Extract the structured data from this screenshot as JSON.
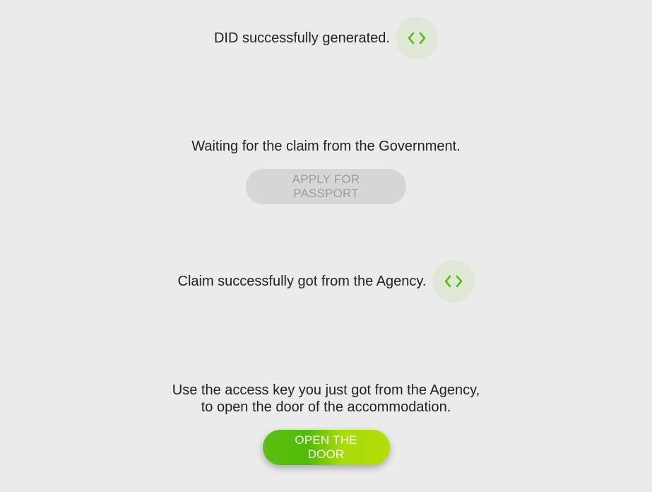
{
  "steps": {
    "did": {
      "message": "DID successfully generated.",
      "icon": "code-icon"
    },
    "government": {
      "message": "Waiting for the claim from the Government.",
      "button_label": "APPLY FOR PASSPORT"
    },
    "agency": {
      "message": "Claim successfully got from the Agency.",
      "icon": "code-icon"
    },
    "door": {
      "message_line1": "Use the access key you just got from the Agency,",
      "message_line2": "to open the door of the accommodation.",
      "button_label": "OPEN THE DOOR"
    }
  },
  "colors": {
    "background": "#ebebeb",
    "accent_green": "#56bd0d",
    "accent_lime": "#b2de06",
    "icon_bg": "#dfe8d6",
    "disabled_bg": "#d6d6d6",
    "disabled_text": "#9c9c9c"
  }
}
